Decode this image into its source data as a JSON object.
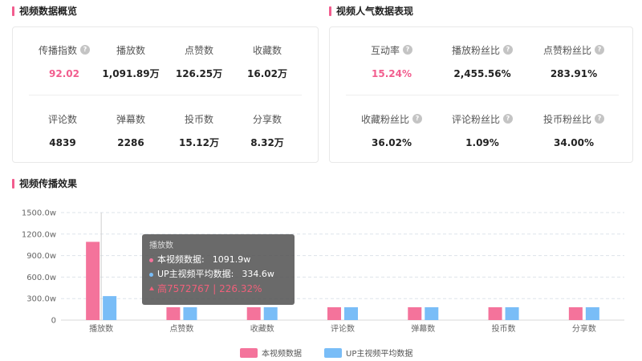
{
  "overview": {
    "title": "视频数据概览",
    "row1": [
      {
        "label": "传播指数",
        "value": "92.02",
        "help": true,
        "highlight": true
      },
      {
        "label": "播放数",
        "value": "1,091.89万",
        "help": false,
        "highlight": false
      },
      {
        "label": "点赞数",
        "value": "126.25万",
        "help": false,
        "highlight": false
      },
      {
        "label": "收藏数",
        "value": "16.02万",
        "help": false,
        "highlight": false
      }
    ],
    "row2": [
      {
        "label": "评论数",
        "value": "4839"
      },
      {
        "label": "弹幕数",
        "value": "2286"
      },
      {
        "label": "投币数",
        "value": "15.12万"
      },
      {
        "label": "分享数",
        "value": "8.32万"
      }
    ]
  },
  "popularity": {
    "title": "视频人气数据表现",
    "row1": [
      {
        "label": "互动率",
        "value": "15.24%",
        "highlight": true
      },
      {
        "label": "播放粉丝比",
        "value": "2,455.56%",
        "highlight": false
      },
      {
        "label": "点赞粉丝比",
        "value": "283.91%",
        "highlight": false
      }
    ],
    "row2": [
      {
        "label": "收藏粉丝比",
        "value": "36.02%"
      },
      {
        "label": "评论粉丝比",
        "value": "1.09%"
      },
      {
        "label": "投币粉丝比",
        "value": "34.00%"
      }
    ]
  },
  "effect": {
    "title": "视频传播效果"
  },
  "tooltip": {
    "title": "播放数",
    "row1_label": "本视频数据:",
    "row1_value": "1091.9w",
    "row2_label": "UP主视频平均数据:",
    "row2_value": "334.6w",
    "diff": "高7572767 | 226.32%"
  },
  "colors": {
    "pink": "#f4739b",
    "blue": "#79bdf7",
    "accent": "#f25d8e"
  },
  "chart_data": {
    "type": "bar",
    "categories": [
      "播放数",
      "点赞数",
      "收藏数",
      "评论数",
      "弹幕数",
      "投币数",
      "分享数"
    ],
    "series": [
      {
        "name": "本视频数据",
        "values": [
          1091.9,
          126.25,
          16.02,
          0.48,
          0.23,
          15.12,
          8.32
        ]
      },
      {
        "name": "UP主视频平均数据",
        "values": [
          334.6,
          0,
          0,
          0,
          0,
          0,
          0
        ]
      }
    ],
    "y_ticks": [
      "0",
      "300.0w",
      "600.0w",
      "900.0w",
      "1200.0w",
      "1500.0w"
    ],
    "ylim": [
      0,
      1500
    ],
    "grid": true,
    "legend": "bottom-center",
    "hovered_category": "播放数"
  }
}
